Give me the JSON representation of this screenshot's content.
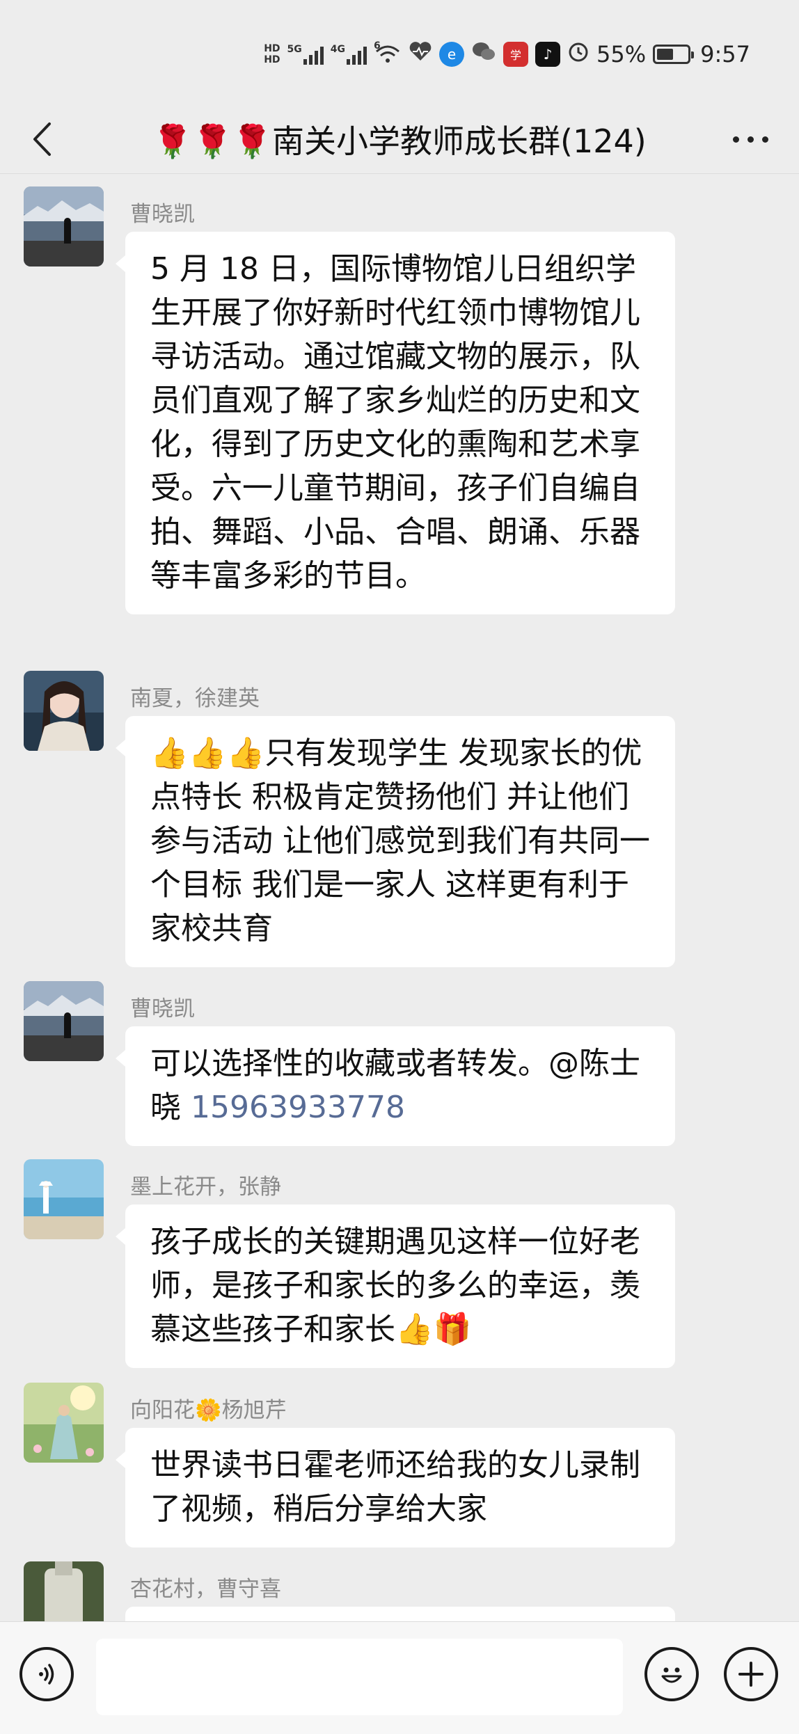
{
  "status_bar": {
    "hd_labels": [
      "HD",
      "HD"
    ],
    "network_1": "5G",
    "network_2": "4G",
    "wifi_badge": "6",
    "battery_percent": "55%",
    "battery_level": 0.55,
    "time": "9:57"
  },
  "header": {
    "title": "🌹🌹🌹南关小学教师成长群(124)"
  },
  "messages": [
    {
      "sender": "曹晓凯",
      "text": "5 月 18 日，国际博物馆儿日组织学生开展了你好新时代红领巾博物馆儿寻访活动。通过馆藏文物的展示，队员们直观了解了家乡灿烂的历史和文化，得到了历史文化的熏陶和艺术享受。六一儿童节期间，孩子们自编自拍、舞蹈、小品、合唱、朗诵、乐器等丰富多彩的节目。"
    },
    {
      "sender": "南夏，徐建英",
      "text": "👍👍👍只有发现学生 发现家长的优点特长  积极肯定赞扬他们 并让他们参与活动  让他们感觉到我们有共同一个目标 我们是一家人   这样更有利于家校共育"
    },
    {
      "sender": "曹晓凯",
      "text": "可以选择性的收藏或者转发。@陈士晓 ",
      "link": "15963933778"
    },
    {
      "sender": "墨上花开，张静",
      "text": "孩子成长的关键期遇见这样一位好老师，是孩子和家长的多么的幸运，羡慕这些孩子和家长👍🎁"
    },
    {
      "sender": "向阳花🌼杨旭芹",
      "text": "世界读书日霍老师还给我的女儿录制了视频，稍后分享给大家"
    },
    {
      "sender": "杏花村，曹守喜",
      "text": ""
    }
  ],
  "input_bar": {
    "value": ""
  },
  "icons": {
    "back": "chevron-left-icon",
    "more": "more-dots-icon",
    "voice": "voice-icon",
    "emoji": "emoji-icon",
    "plus": "plus-icon"
  }
}
